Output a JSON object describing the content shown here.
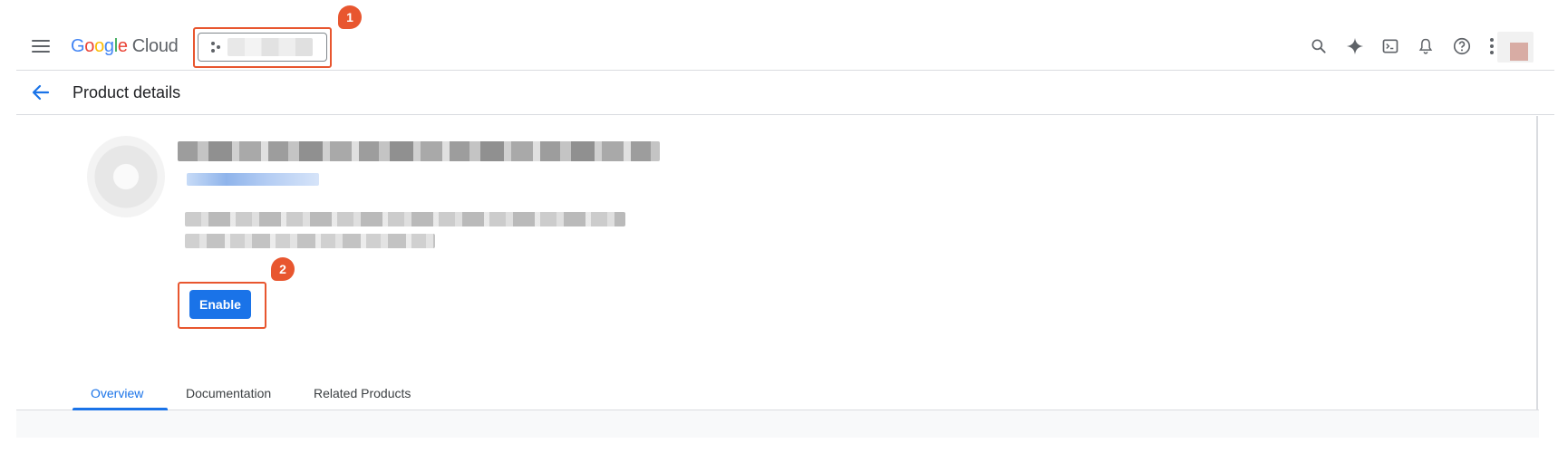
{
  "header": {
    "logo_google": [
      "G",
      "o",
      "o",
      "g",
      "l",
      "e"
    ],
    "logo_cloud": "Cloud",
    "project_picker": {
      "annotation": "1"
    },
    "icons": [
      "menu-icon",
      "search-icon",
      "gemini-spark-icon",
      "cloud-shell-icon",
      "notifications-icon",
      "help-icon",
      "more-vert-icon"
    ]
  },
  "subheader": {
    "title": "Product details"
  },
  "product": {
    "enable_label": "Enable",
    "annotation": "2"
  },
  "tabs": [
    {
      "label": "Overview",
      "active": true
    },
    {
      "label": "Documentation",
      "active": false
    },
    {
      "label": "Related Products",
      "active": false
    }
  ],
  "colors": {
    "accent": "#1a73e8",
    "annotation": "#e8562f"
  }
}
